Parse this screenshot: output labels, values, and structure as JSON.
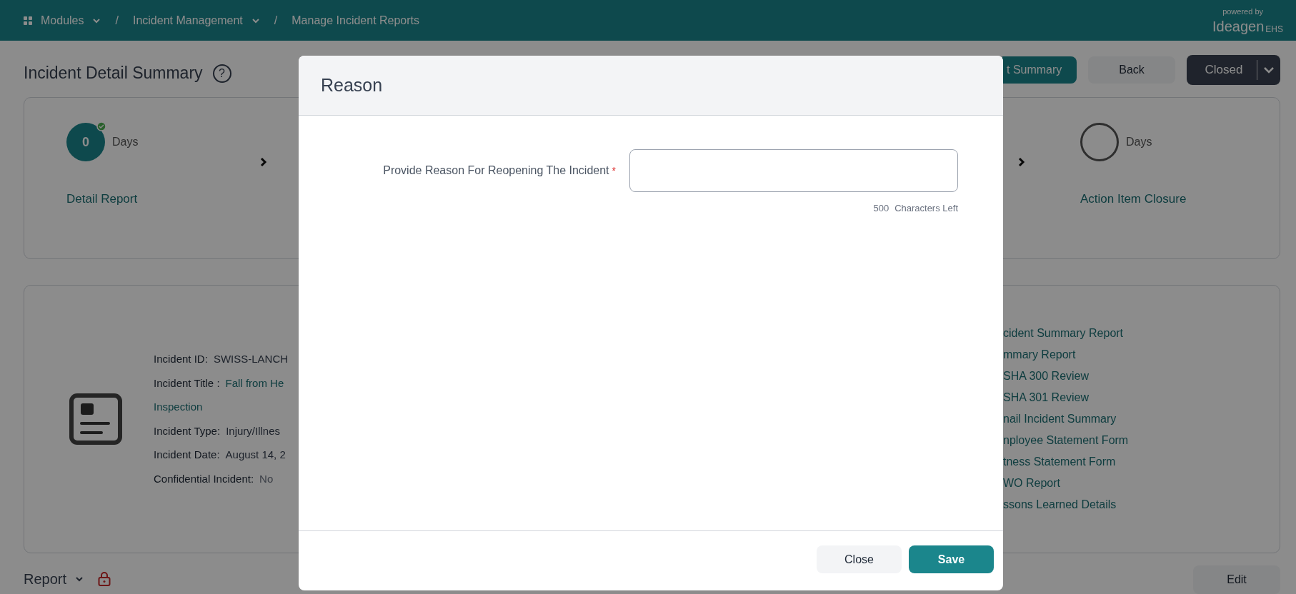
{
  "top_bar": {
    "breadcrumbs": [
      {
        "label": "Modules",
        "has_menu": true,
        "kind": "apps"
      },
      {
        "label": "Incident Management",
        "has_menu": true,
        "kind": "plain",
        "separator": "/"
      },
      {
        "label": "Manage Incident Reports",
        "has_menu": false,
        "kind": "plain",
        "separator": "/"
      }
    ],
    "logo": {
      "tagline": "powered by",
      "name": "Ideagen",
      "product": "EHS"
    }
  },
  "page": {
    "title": "Incident Detail Summary",
    "help_glyph": "?",
    "header_buttons": [
      {
        "label": "t Summary",
        "kind": "primary"
      },
      {
        "label": "Back",
        "kind": "secondary"
      },
      {
        "label": "Closed",
        "kind": "status"
      }
    ],
    "stages": [
      {
        "count": "0",
        "unit": "Days",
        "label": "Detail Report",
        "completed": true
      },
      {
        "unit": "Days",
        "label": "Action Item Closure",
        "completed": false
      }
    ],
    "details": [
      {
        "label": "Incident ID:",
        "value": "SWISS-LANCH",
        "kind": "text"
      },
      {
        "label": "Incident Title :",
        "value": "Fall from He",
        "continuation": "Inspection",
        "kind": "link"
      },
      {
        "label": "Incident Type:",
        "value": "Injury/Illnes",
        "kind": "text"
      },
      {
        "label": "Incident Date:",
        "value": "August 14, 2",
        "kind": "text"
      },
      {
        "label": "Confidential Incident:",
        "value": "No",
        "kind": "muted"
      }
    ],
    "report_links": [
      "cident Summary Report",
      "mmary Report",
      "SHA 300 Review",
      "SHA 301 Review",
      "nail Incident Summary",
      "nployee Statement Form",
      "tness Statement Form",
      "WO Report",
      "ssons Learned Details"
    ],
    "report_section": {
      "label": "Report",
      "locked": true
    },
    "edit_button": "Edit"
  },
  "modal": {
    "title": "Reason",
    "field": {
      "label": "Provide Reason For Reopening The Incident",
      "required_marker": "*"
    },
    "counter": {
      "count": "500",
      "text": "Characters Left"
    },
    "buttons": [
      {
        "label": "Close",
        "kind": "secondary"
      },
      {
        "label": "Save",
        "kind": "primary"
      }
    ]
  }
}
